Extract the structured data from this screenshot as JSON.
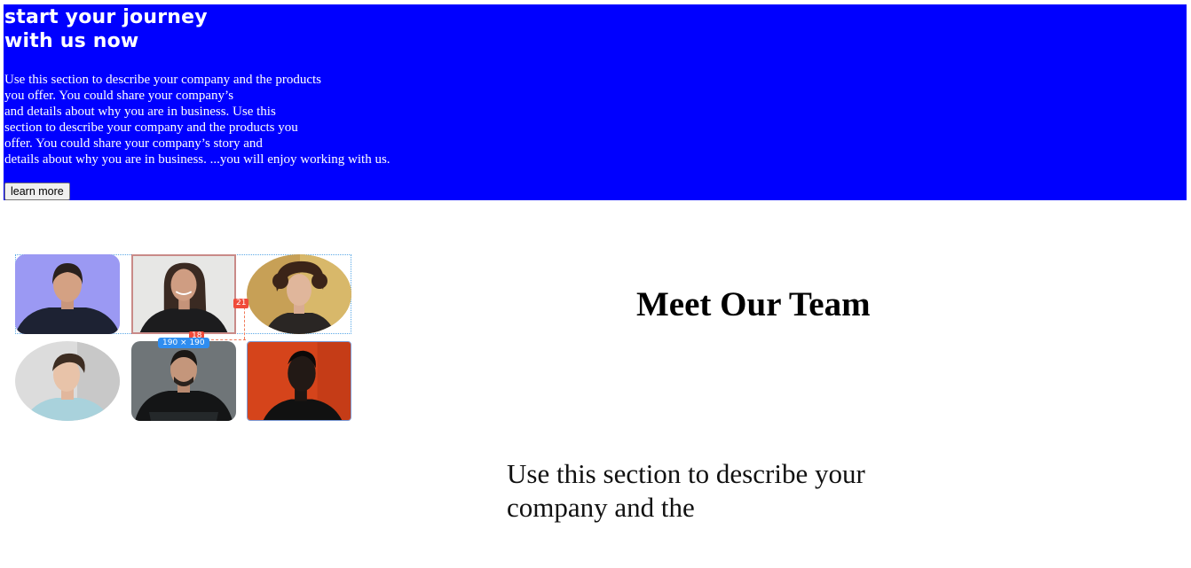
{
  "hero": {
    "title_line1": "start your journey",
    "title_line2": "with us now",
    "text_lines": [
      "Use this section to describe your company and the products",
      "you offer. You could share your company’s",
      "and details about why you are in business. Use this",
      "section to describe your company and the products you",
      "offer. You could share your company’s story and",
      "details about why you are in business. ...you will enjoy working with us."
    ],
    "button_label": "learn more",
    "background_color": "#0000ff"
  },
  "team_grid": {
    "photos": [
      {
        "name": "woman with short dark hair, purple backdrop"
      },
      {
        "name": "smiling woman with long dark hair"
      },
      {
        "name": "woman with curly hair, golden backdrop"
      },
      {
        "name": "man with styled hair, light backdrop"
      },
      {
        "name": "man in black hoodie, arms crossed"
      },
      {
        "name": "man in profile, orange backdrop"
      }
    ],
    "measure_labels": {
      "spacing_right": "21",
      "spacing_bottom": "18",
      "size": "190 × 190"
    }
  },
  "team": {
    "heading": "Meet Our Team",
    "description_line1": "Use this section to describe your",
    "description_line2": "company and the"
  }
}
